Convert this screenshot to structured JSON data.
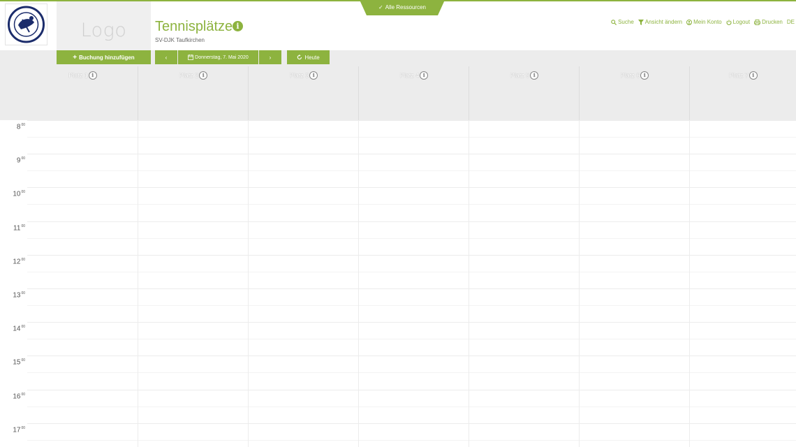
{
  "header": {
    "resources_label": "Alle Ressourcen",
    "logo_placeholder": "Logo",
    "title": "Tennisplätze",
    "title_info": "i",
    "subtitle": "SV-DJK Taufkirchen",
    "club_logo": {
      "top_text": "SV-DJK",
      "bottom_text": "TAUFKIRCHEN"
    }
  },
  "nav": {
    "items": [
      {
        "label": "Suche",
        "icon": "search-icon"
      },
      {
        "label": "Ansicht ändern",
        "icon": "filter-icon"
      },
      {
        "label": "Mein Konto",
        "icon": "user-icon"
      },
      {
        "label": "Logout",
        "icon": "power-icon"
      },
      {
        "label": "Drucken",
        "icon": "print-icon"
      },
      {
        "label": "DE",
        "icon": ""
      }
    ]
  },
  "toolbar": {
    "add_booking": "Buchung hinzufügen",
    "add_icon": "+",
    "prev": "‹",
    "date": "Donnerstag, 7. Mai 2020",
    "next": "›",
    "today": "Heute"
  },
  "courts": [
    "Platz 1",
    "Platz 2",
    "Platz 3",
    "Platz 4",
    "Platz 5",
    "Platz 6",
    "Platz 7"
  ],
  "hours": [
    "8",
    "9",
    "10",
    "11",
    "12",
    "13",
    "14",
    "15",
    "16",
    "17"
  ],
  "hour_suffix": "00",
  "colors": {
    "accent": "#8db33f",
    "header_bg": "#ececec"
  }
}
